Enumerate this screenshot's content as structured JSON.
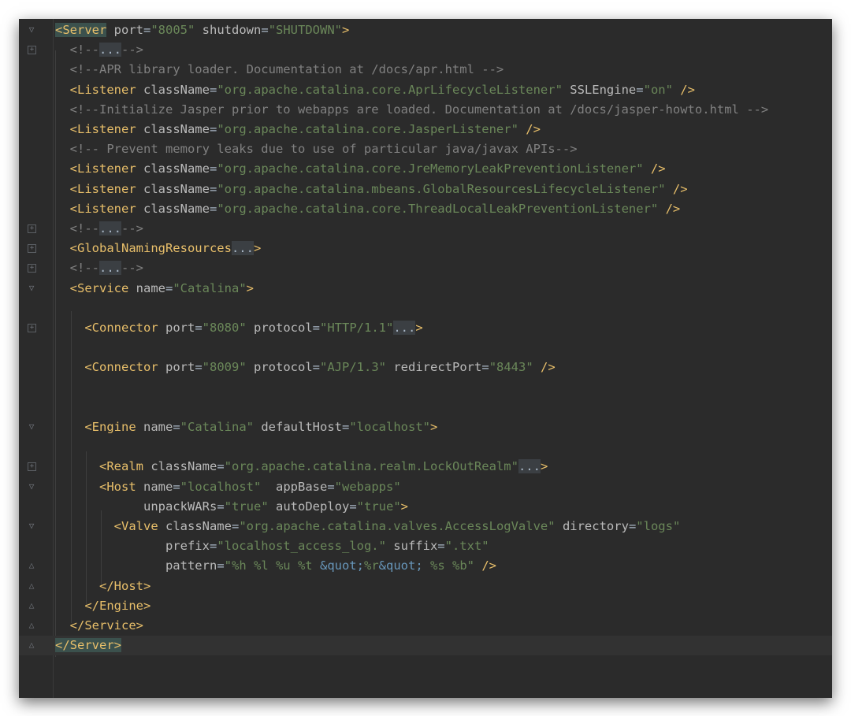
{
  "editor": {
    "colors": {
      "background": "#2b2b2b",
      "tag": "#e8bf6a",
      "attribute": "#bababa",
      "string": "#6a8759",
      "comment": "#808080",
      "entity": "#6897bb"
    },
    "lines": [
      {
        "fold": "open",
        "tokens": [
          [
            "tag",
            "<Server",
            true
          ],
          [
            "attr",
            " port"
          ],
          [
            "eq",
            "="
          ],
          [
            "str",
            "\"8005\""
          ],
          [
            "attr",
            " shutdown"
          ],
          [
            "eq",
            "="
          ],
          [
            "str",
            "\"SHUTDOWN\""
          ],
          [
            "tag",
            ">"
          ]
        ]
      },
      {
        "fold": "box",
        "tokens": [
          [
            "cmt",
            "  <!--"
          ],
          [
            "fold",
            "..."
          ],
          [
            "cmt",
            "-->"
          ]
        ]
      },
      {
        "tokens": [
          [
            "cmt",
            "  <!--APR library loader. Documentation at /docs/apr.html -->"
          ]
        ]
      },
      {
        "tokens": [
          [
            "tag",
            "  <Listener"
          ],
          [
            "attr",
            " className"
          ],
          [
            "eq",
            "="
          ],
          [
            "str",
            "\"org.apache.catalina.core.AprLifecycleListener\""
          ],
          [
            "attr",
            " SSLEngine"
          ],
          [
            "eq",
            "="
          ],
          [
            "str",
            "\"on\""
          ],
          [
            "tag",
            " />"
          ]
        ]
      },
      {
        "tokens": [
          [
            "cmt",
            "  <!--Initialize Jasper prior to webapps are loaded. Documentation at /docs/jasper-howto.html -->"
          ]
        ]
      },
      {
        "tokens": [
          [
            "tag",
            "  <Listener"
          ],
          [
            "attr",
            " className"
          ],
          [
            "eq",
            "="
          ],
          [
            "str",
            "\"org.apache.catalina.core.JasperListener\""
          ],
          [
            "tag",
            " />"
          ]
        ]
      },
      {
        "tokens": [
          [
            "cmt",
            "  <!-- Prevent memory leaks due to use of particular java/javax APIs-->"
          ]
        ]
      },
      {
        "tokens": [
          [
            "tag",
            "  <Listener"
          ],
          [
            "attr",
            " className"
          ],
          [
            "eq",
            "="
          ],
          [
            "str",
            "\"org.apache.catalina.core.JreMemoryLeakPreventionListener\""
          ],
          [
            "tag",
            " />"
          ]
        ]
      },
      {
        "tokens": [
          [
            "tag",
            "  <Listener"
          ],
          [
            "attr",
            " className"
          ],
          [
            "eq",
            "="
          ],
          [
            "str",
            "\"org.apache.catalina.mbeans.GlobalResourcesLifecycleListener\""
          ],
          [
            "tag",
            " />"
          ]
        ]
      },
      {
        "tokens": [
          [
            "tag",
            "  <Listener"
          ],
          [
            "attr",
            " className"
          ],
          [
            "eq",
            "="
          ],
          [
            "str",
            "\"org.apache.catalina.core.ThreadLocalLeakPreventionListener\""
          ],
          [
            "tag",
            " />"
          ]
        ]
      },
      {
        "fold": "box",
        "tokens": [
          [
            "cmt",
            "  <!--"
          ],
          [
            "fold",
            "..."
          ],
          [
            "cmt",
            "-->"
          ]
        ]
      },
      {
        "fold": "box",
        "tokens": [
          [
            "tag",
            "  <GlobalNamingResources"
          ],
          [
            "fold",
            "..."
          ],
          [
            "tag",
            ">"
          ]
        ]
      },
      {
        "fold": "box",
        "tokens": [
          [
            "cmt",
            "  <!--"
          ],
          [
            "fold",
            "..."
          ],
          [
            "cmt",
            "-->"
          ]
        ]
      },
      {
        "fold": "open",
        "tokens": [
          [
            "tag",
            "  <Service"
          ],
          [
            "attr",
            " name"
          ],
          [
            "eq",
            "="
          ],
          [
            "str",
            "\"Catalina\""
          ],
          [
            "tag",
            ">"
          ]
        ]
      },
      {
        "tokens": []
      },
      {
        "fold": "box",
        "tokens": [
          [
            "tag",
            "    <Connector"
          ],
          [
            "attr",
            " port"
          ],
          [
            "eq",
            "="
          ],
          [
            "str",
            "\"8080\""
          ],
          [
            "attr",
            " protocol"
          ],
          [
            "eq",
            "="
          ],
          [
            "str",
            "\"HTTP/1.1\""
          ],
          [
            "fold",
            "..."
          ],
          [
            "tag",
            ">"
          ]
        ]
      },
      {
        "tokens": []
      },
      {
        "tokens": [
          [
            "tag",
            "    <Connector"
          ],
          [
            "attr",
            " port"
          ],
          [
            "eq",
            "="
          ],
          [
            "str",
            "\"8009\""
          ],
          [
            "attr",
            " protocol"
          ],
          [
            "eq",
            "="
          ],
          [
            "str",
            "\"AJP/1.3\""
          ],
          [
            "attr",
            " redirectPort"
          ],
          [
            "eq",
            "="
          ],
          [
            "str",
            "\"8443\""
          ],
          [
            "tag",
            " />"
          ]
        ]
      },
      {
        "tokens": []
      },
      {
        "tokens": []
      },
      {
        "fold": "open",
        "tokens": [
          [
            "tag",
            "    <Engine"
          ],
          [
            "attr",
            " name"
          ],
          [
            "eq",
            "="
          ],
          [
            "str",
            "\"Catalina\""
          ],
          [
            "attr",
            " defaultHost"
          ],
          [
            "eq",
            "="
          ],
          [
            "str",
            "\"localhost\""
          ],
          [
            "tag",
            ">"
          ]
        ]
      },
      {
        "tokens": []
      },
      {
        "fold": "box",
        "tokens": [
          [
            "tag",
            "      <Realm"
          ],
          [
            "attr",
            " className"
          ],
          [
            "eq",
            "="
          ],
          [
            "str",
            "\"org.apache.catalina.realm.LockOutRealm\""
          ],
          [
            "fold",
            "..."
          ],
          [
            "tag",
            ">"
          ]
        ]
      },
      {
        "fold": "open",
        "tokens": [
          [
            "tag",
            "      <Host"
          ],
          [
            "attr",
            " name"
          ],
          [
            "eq",
            "="
          ],
          [
            "str",
            "\"localhost\""
          ],
          [
            "attr",
            "  appBase"
          ],
          [
            "eq",
            "="
          ],
          [
            "str",
            "\"webapps\""
          ]
        ]
      },
      {
        "tokens": [
          [
            "attr",
            "            unpackWARs"
          ],
          [
            "eq",
            "="
          ],
          [
            "str",
            "\"true\""
          ],
          [
            "attr",
            " autoDeploy"
          ],
          [
            "eq",
            "="
          ],
          [
            "str",
            "\"true\""
          ],
          [
            "tag",
            ">"
          ]
        ]
      },
      {
        "fold": "open",
        "tokens": [
          [
            "tag",
            "        <Valve"
          ],
          [
            "attr",
            " className"
          ],
          [
            "eq",
            "="
          ],
          [
            "str",
            "\"org.apache.catalina.valves.AccessLogValve\""
          ],
          [
            "attr",
            " directory"
          ],
          [
            "eq",
            "="
          ],
          [
            "str",
            "\"logs\""
          ]
        ]
      },
      {
        "tokens": [
          [
            "attr",
            "               prefix"
          ],
          [
            "eq",
            "="
          ],
          [
            "str",
            "\"localhost_access_log.\""
          ],
          [
            "attr",
            " suffix"
          ],
          [
            "eq",
            "="
          ],
          [
            "str",
            "\".txt\""
          ]
        ]
      },
      {
        "fold": "close",
        "tokens": [
          [
            "attr",
            "               pattern"
          ],
          [
            "eq",
            "="
          ],
          [
            "str",
            "\"%h %l %u %t "
          ],
          [
            "ent",
            "&quot;"
          ],
          [
            "str",
            "%r"
          ],
          [
            "ent",
            "&quot;"
          ],
          [
            "str",
            " %s %b\""
          ],
          [
            "tag",
            " />"
          ]
        ]
      },
      {
        "fold": "close",
        "tokens": [
          [
            "tag",
            "      </Host>"
          ]
        ]
      },
      {
        "fold": "close",
        "tokens": [
          [
            "tag",
            "    </Engine>"
          ]
        ]
      },
      {
        "fold": "close",
        "tokens": [
          [
            "tag",
            "  </Service>"
          ]
        ]
      },
      {
        "fold": "close",
        "current": true,
        "tokens": [
          [
            "tag",
            "</Server>",
            true
          ]
        ]
      }
    ]
  }
}
